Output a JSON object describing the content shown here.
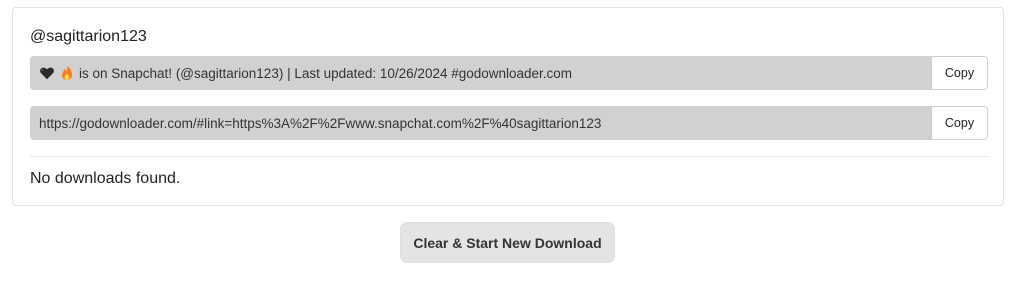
{
  "profile": {
    "username": "@sagittarion123"
  },
  "share_text": {
    "icons": [
      "black-heart-icon",
      "fire-icon"
    ],
    "value": "is on Snapchat! (@sagittarion123) | Last updated: 10/26/2024 #godownloader.com",
    "copy_label": "Copy"
  },
  "share_link": {
    "value": "https://godownloader.com/#link=https%3A%2F%2Fwww.snapchat.com%2F%40sagittarion123",
    "copy_label": "Copy"
  },
  "downloads": {
    "empty_message": "No downloads found."
  },
  "actions": {
    "clear_label": "Clear & Start New Download"
  },
  "colors": {
    "field_bg": "#d1d1d1",
    "button_bg": "#e4e4e4",
    "heart": "#2b2b2b",
    "fire": "#f5811f"
  }
}
